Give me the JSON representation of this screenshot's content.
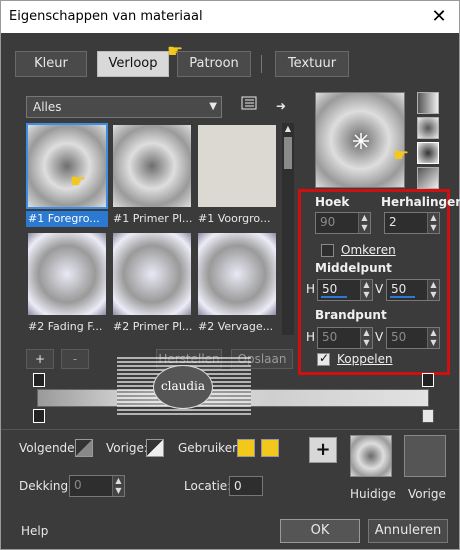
{
  "window": {
    "title": "Eigenschappen van materiaal",
    "close_label": "✕"
  },
  "tabs": [
    {
      "label": "Kleur",
      "active": false
    },
    {
      "label": "Verloop",
      "active": true
    },
    {
      "label": "Patroon",
      "active": false
    },
    {
      "label": "Textuur",
      "active": false
    }
  ],
  "library": {
    "selected": "Alles",
    "arrow_label": "➜"
  },
  "gradients": [
    {
      "caption": "#1 Foregro...",
      "selected": true
    },
    {
      "caption": "#1 Primer Pl...",
      "selected": false
    },
    {
      "caption": "#1 Voorgro...",
      "selected": false
    },
    {
      "caption": "#2 Fading F...",
      "selected": false
    },
    {
      "caption": "#2 Primer Pl...",
      "selected": false
    },
    {
      "caption": "#2 Vervage...",
      "selected": false
    }
  ],
  "settings": {
    "hoek_label": "Hoek",
    "hoek_value": "90",
    "herhalingen_label": "Herhalingen",
    "herhalingen_value": "2",
    "omkeren_label": "Omkeren",
    "omkeren_checked": false,
    "middelpunt_label": "Middelpunt",
    "h_label": "H",
    "v_label": "V",
    "middelpunt_h": "50",
    "middelpunt_v": "50",
    "brandpunt_label": "Brandpunt",
    "brandpunt_h": "50",
    "brandpunt_v": "50",
    "koppelen_label": "Koppelen",
    "koppelen_checked": true
  },
  "editor": {
    "add_label": "+",
    "remove_label": "-",
    "import_label": "Herstellen",
    "save_label": "Opslaan",
    "watermark_text": "claudia"
  },
  "bottom": {
    "volgende_label": "Volgende:",
    "vorige_label": "Vorige:",
    "gebruiker_label": "Gebruiker:",
    "dekking_label": "Dekking:",
    "dekking_value": "0",
    "locatie_label": "Locatie:",
    "locatie_value": "0",
    "add_button_label": "+",
    "huidige_label": "Huidige",
    "vorige_preview_label": "Vorige",
    "user_color_1": "#f2c81c",
    "user_color_2": "#f2c81c"
  },
  "footer": {
    "help_label": "Help",
    "ok_label": "OK",
    "cancel_label": "Annuleren"
  }
}
